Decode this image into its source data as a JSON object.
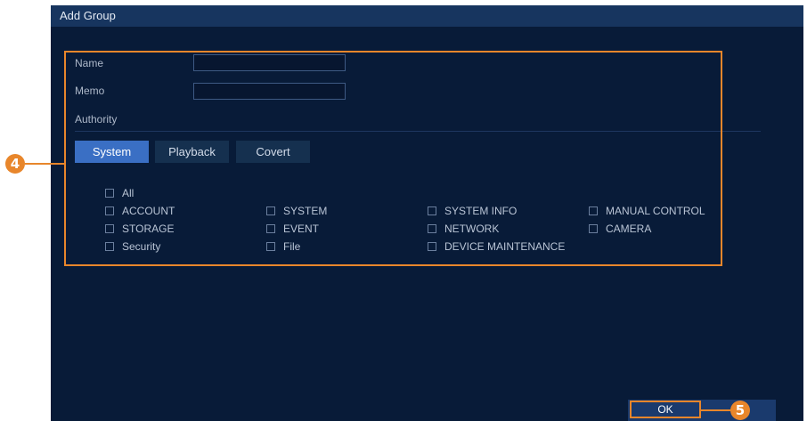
{
  "dialog": {
    "title": "Add Group"
  },
  "form": {
    "name_label": "Name",
    "name_value": "",
    "memo_label": "Memo",
    "memo_value": "",
    "authority_label": "Authority"
  },
  "tabs": [
    {
      "label": "System",
      "active": true
    },
    {
      "label": "Playback",
      "active": false
    },
    {
      "label": "Covert",
      "active": false
    }
  ],
  "permissions": {
    "all": "All",
    "col1": [
      "ACCOUNT",
      "STORAGE",
      "Security"
    ],
    "col2": [
      "SYSTEM",
      "EVENT",
      "File"
    ],
    "col3": [
      "SYSTEM INFO",
      "NETWORK",
      "DEVICE MAINTENANCE"
    ],
    "col4": [
      "MANUAL CONTROL",
      "CAMERA"
    ]
  },
  "buttons": {
    "ok": "OK"
  },
  "callouts": {
    "step4": "4",
    "step5": "5"
  },
  "colors": {
    "accent": "#e8862b",
    "dialog_bg": "#081b38",
    "titlebar_bg": "#17355f",
    "tab_active": "#3a6fc4"
  }
}
